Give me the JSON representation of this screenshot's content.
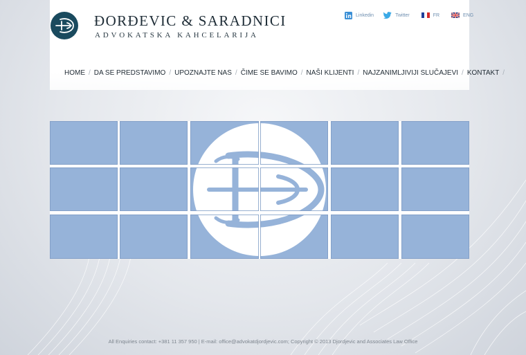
{
  "brand": {
    "name": "ĐORĐEVIC & SARADNICI",
    "subtitle": "ADVOKATSKA KAHCELARIJA"
  },
  "top_links": [
    {
      "label": "Linkedin",
      "icon": "linkedin-icon"
    },
    {
      "label": "Twitter",
      "icon": "twitter-icon"
    },
    {
      "label": "FR",
      "icon": "flag-fr-icon"
    },
    {
      "label": "ENG",
      "icon": "flag-uk-icon"
    }
  ],
  "nav": {
    "items": [
      "HOME",
      "DA SE PREDSTAVIMO",
      "UPOZNAJTE NAS",
      "ČIME SE BAVIMO",
      "NAŠI KLIJENTI",
      "NAJZANIMLJIVIJI SLUČAJEVI",
      "KONTAKT"
    ],
    "separator": "/"
  },
  "colors": {
    "tile": "#96b3d9",
    "tile_border": "#7f9cc4",
    "logo_bg": "#1a4a5e",
    "text_dark": "#1e2c36",
    "link": "#6f8fb0"
  },
  "footer": {
    "text": "All Enquiries contact: +381 11 357 950 | E-mail: office@advokatdjordjevic.com; Copyright © 2013 Djordjevic and Associates Law Office"
  }
}
